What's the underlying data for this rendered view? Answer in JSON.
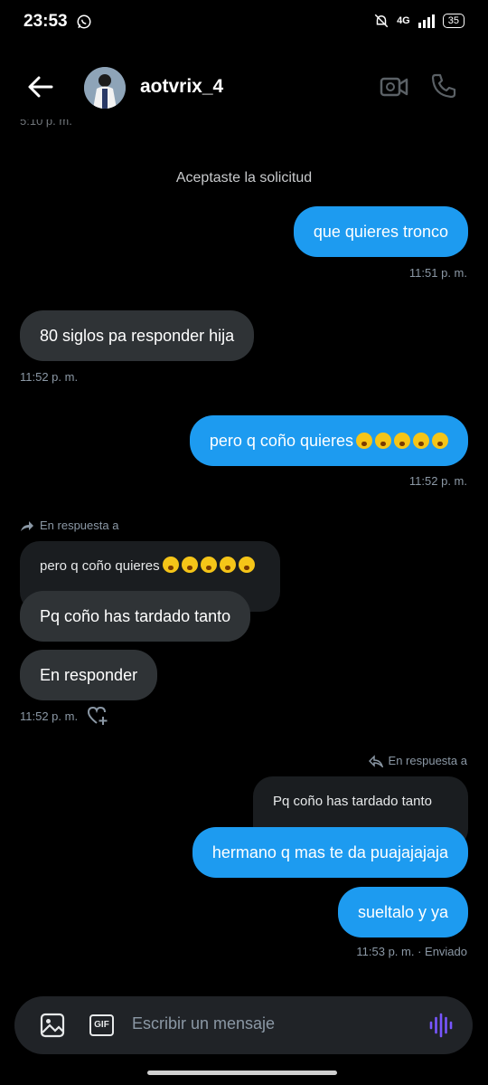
{
  "status": {
    "time": "23:53",
    "network": "4G",
    "battery": "35"
  },
  "header": {
    "username": "aotvrix_4"
  },
  "peek_time": "5:10 p. m.",
  "system_message": "Aceptaste la solicitud",
  "messages": [
    {
      "text": "que quieres tronco",
      "time": "11:51 p. m."
    },
    {
      "text": "80 siglos pa responder hija",
      "time": "11:52 p. m."
    },
    {
      "text": "pero q coño quieres",
      "time": "11:52 p. m."
    },
    {
      "reply_label": "En respuesta a",
      "quoted": "pero q coño quieres",
      "text": "Pq coño has tardado tanto"
    },
    {
      "text": "En responder",
      "time": "11:52 p. m."
    },
    {
      "reply_label": "En respuesta a",
      "quoted": "Pq coño has tardado tanto",
      "text": "hermano q mas te da puajajajaja"
    },
    {
      "text": "sueltalo y ya",
      "time": "11:53 p. m. · Enviado"
    }
  ],
  "composer": {
    "placeholder": "Escribir un mensaje",
    "gif_label": "GIF"
  },
  "icons": [
    "whatsapp-icon",
    "mute-icon",
    "signal-icon",
    "battery-icon",
    "back-arrow-icon",
    "video-call-icon",
    "phone-icon",
    "reply-arrow-icon",
    "like-add-icon",
    "image-icon",
    "gif-icon",
    "voice-icon",
    "crying-emoji-icon"
  ],
  "colors": {
    "accent": "#1d9bf0",
    "incoming": "#2f3336",
    "background": "#000000",
    "voice": "#7856ff"
  }
}
